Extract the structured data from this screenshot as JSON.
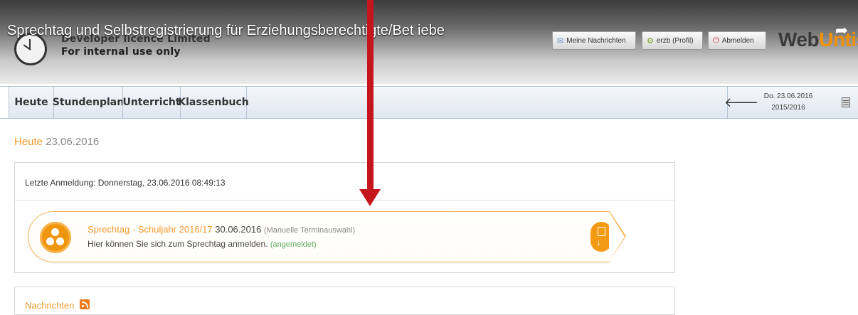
{
  "overlay": {
    "video_title": "Sprechtag und Selbstregistrierung für Erziehungsberechtigte/Bet  iebe"
  },
  "header": {
    "licence_line1": "Developer licence Limited",
    "licence_line2": "For internal use only",
    "buttons": {
      "messages": "Meine Nachrichten",
      "profile": "erzb (Profil)",
      "logout": "Abmelden"
    },
    "logo": {
      "part1": "Web",
      "part2": "Untis"
    }
  },
  "nav": {
    "tabs": [
      "Heute",
      "Stundenplan",
      "Unterricht",
      "Klassenbuch"
    ],
    "date_line1": "Do. 23.06.2016",
    "date_line2": "2015/2016"
  },
  "page": {
    "title_label": "Heute",
    "title_date": "23.06.2016",
    "last_login": "Letzte Anmeldung: Donnerstag, 23.06.2016 08:49:13",
    "sprechtag": {
      "title": "Sprechtag - Schuljahr 2016/17",
      "date": "30.06.2016",
      "mode": "(Manuelle Terminauswahl)",
      "info": "Hier können Sie sich zum Sprechtag anmelden.",
      "status": "(angemeldet)"
    },
    "news_title": "Nachrichten"
  },
  "colors": {
    "accent_orange": "#f29a2e",
    "annotation_red": "#c4161c",
    "status_green": "#5fb05f"
  },
  "icons": [
    "clock-logo-icon",
    "share-icon",
    "mail-icon",
    "gear-icon",
    "power-icon",
    "back-arrow-icon",
    "calendar-icon",
    "sprechtag-icon",
    "download-icon",
    "rss-icon"
  ]
}
